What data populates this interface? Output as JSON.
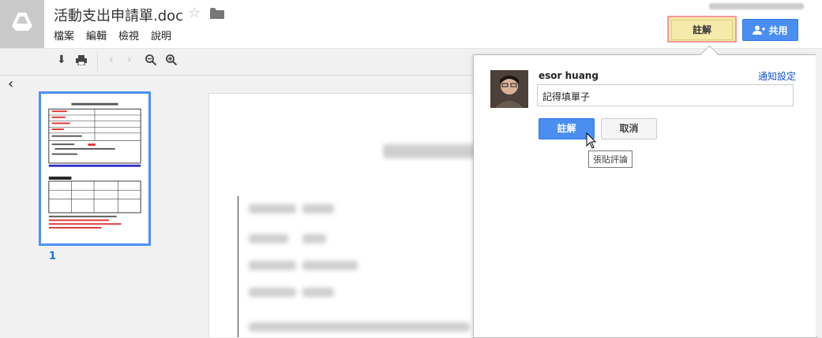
{
  "header": {
    "doc_title": "活動支出申請單.doc",
    "menu": [
      "檔案",
      "編輯",
      "檢視",
      "說明"
    ],
    "comment_button": "註解",
    "share_button": "共用"
  },
  "left_panel": {
    "page_number": "1"
  },
  "comment_panel": {
    "user_name": "esor huang",
    "notify_link": "通知設定",
    "comment_text": "記得填單子",
    "submit_button": "註解",
    "cancel_button": "取消",
    "tooltip": "張貼評論"
  },
  "colors": {
    "accent_blue": "#4a8ef0",
    "highlight_yellow": "#f5eaaa",
    "highlight_border": "#f39a9a",
    "link_blue": "#1155cc"
  }
}
